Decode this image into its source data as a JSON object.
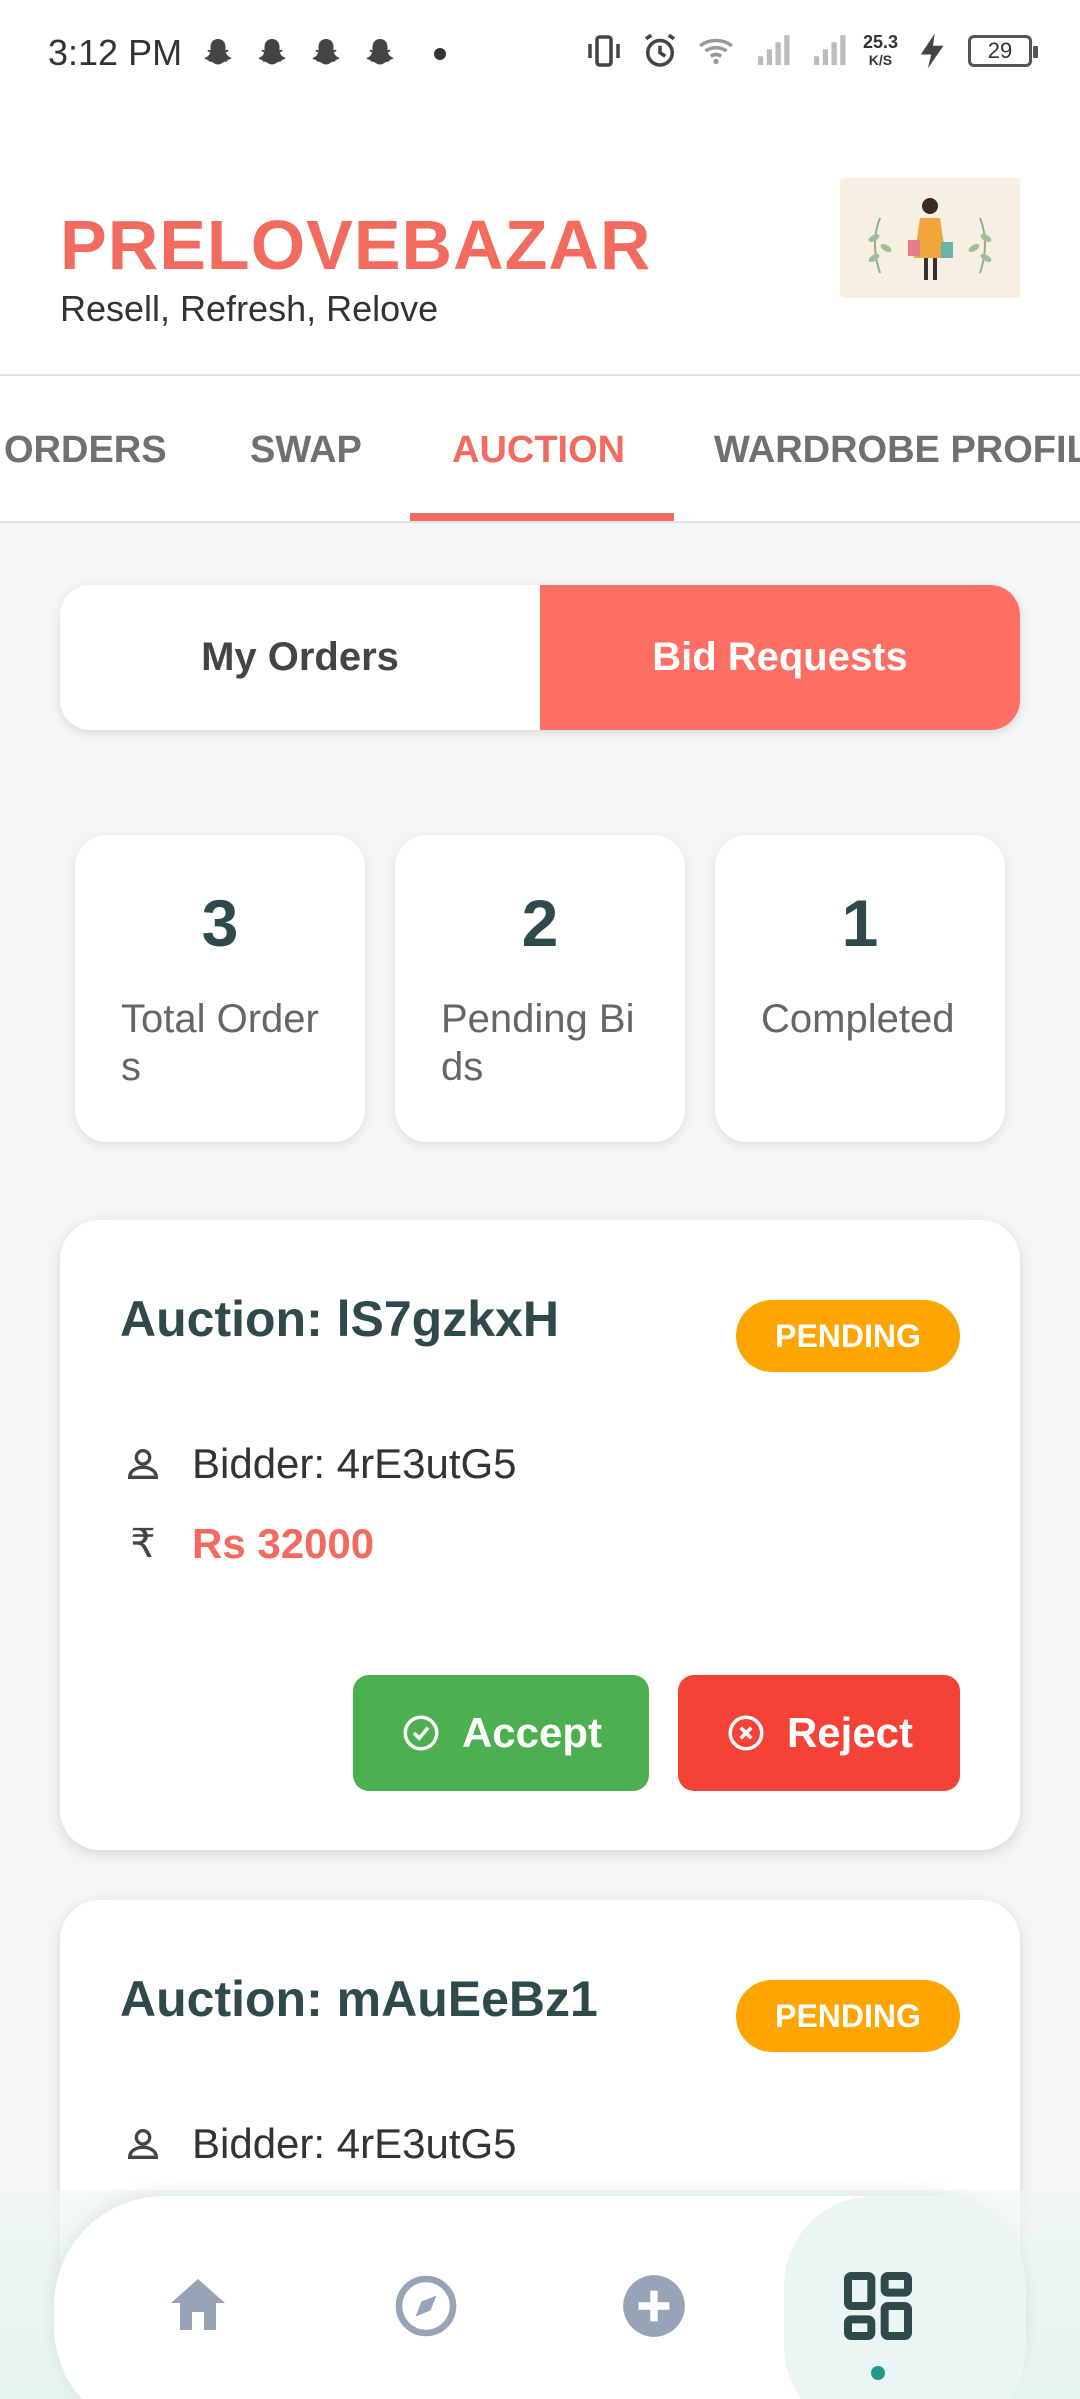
{
  "status_bar": {
    "time": "3:12 PM",
    "speed_value": "25.3",
    "speed_unit": "K/S",
    "battery": "29"
  },
  "header": {
    "brand": "PRELOVEBAZAR",
    "tagline": "Resell, Refresh, Relove"
  },
  "tabs": [
    {
      "label": "ORDERS"
    },
    {
      "label": "SWAP"
    },
    {
      "label": "AUCTION",
      "active": true
    },
    {
      "label": "WARDROBE PROFIL"
    }
  ],
  "segment": {
    "left": "My Orders",
    "right": "Bid Requests",
    "active": "right"
  },
  "stats": [
    {
      "value": "3",
      "label": "Total Orders"
    },
    {
      "value": "2",
      "label": "Pending Bids"
    },
    {
      "value": "1",
      "label": "Completed"
    }
  ],
  "auctions": [
    {
      "title": "Auction: lS7gzkxH",
      "status": "PENDING",
      "bidder": "Bidder: 4rE3utG5",
      "amount": "Rs 32000",
      "accept_label": "Accept",
      "reject_label": "Reject"
    },
    {
      "title": "Auction: mAuEeBz1",
      "status": "PENDING",
      "bidder": "Bidder: 4rE3utG5"
    }
  ],
  "bottom_nav": {
    "items": [
      "home-icon",
      "compass-icon",
      "add-icon",
      "dashboard-icon"
    ],
    "active": "dashboard-icon"
  },
  "colors": {
    "brand": "#f26b5e",
    "segment_active": "#fd6e63",
    "pending": "#ffa500",
    "accept": "#4caf50",
    "reject": "#f44336",
    "nav_active": "#1e9c8a"
  }
}
